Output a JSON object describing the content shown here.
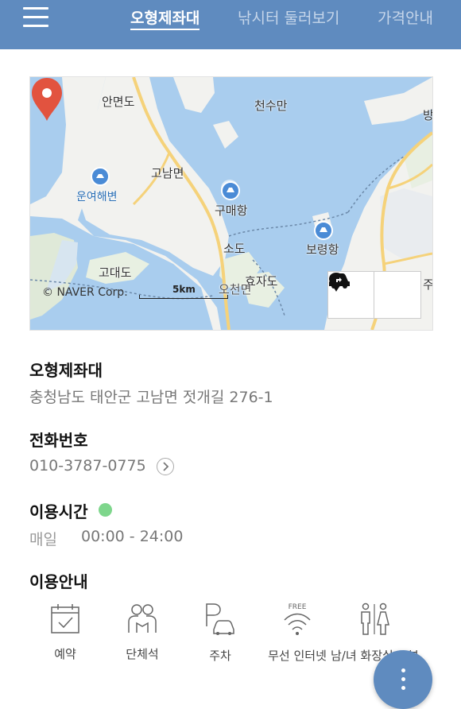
{
  "nav": {
    "menu_icon": "hamburger-menu-icon",
    "tabs": [
      {
        "label": "오형제좌대",
        "active": true
      },
      {
        "label": "낚시터 둘러보기",
        "active": false
      },
      {
        "label": "가격안내",
        "active": false
      }
    ]
  },
  "map": {
    "labels": {
      "anmyeondo": "안면도",
      "cheonsuman": "천수만",
      "gonammyeon": "고남면",
      "unyeohaebyeon": "운여해변",
      "gumaehang": "구매항",
      "sodo": "소도",
      "boryeonghang": "보령항",
      "godaedo": "고대도",
      "hyojado": "효자도",
      "ocheonmyeon": "오천면",
      "edge_right_top": "방",
      "edge_right_bottom": "주"
    },
    "copyright": "© NAVER Corp.",
    "scale": "5km",
    "marker_icon": "location-pin-icon",
    "buttons": [
      {
        "icon": "map-pin-icon"
      },
      {
        "icon": "car-directions-icon"
      }
    ]
  },
  "place": {
    "name": "오형제좌대",
    "address": "충청남도 태안군 고남면 젓개길 276-1"
  },
  "phone": {
    "title": "전화번호",
    "number": "010-3787-0775"
  },
  "hours": {
    "title": "이용시간",
    "status_color": "#7ed68c",
    "day": "매일",
    "time": "00:00 - 24:00"
  },
  "info": {
    "title": "이용안내",
    "amenities": [
      {
        "label": "예약",
        "icon": "calendar-check-icon"
      },
      {
        "label": "단체석",
        "icon": "group-seating-icon"
      },
      {
        "label": "주차",
        "icon": "parking-icon"
      },
      {
        "label": "무선 인터넷",
        "icon": "wifi-free-icon",
        "badge": "FREE"
      },
      {
        "label": "남/녀 화장실 구분",
        "icon": "restroom-icon"
      }
    ]
  },
  "fab_icon": "more-vertical-icon",
  "colors": {
    "header": "#5f8bbf",
    "water": "#a9cdee",
    "marker": "#e2533f",
    "status": "#7ed68c"
  }
}
